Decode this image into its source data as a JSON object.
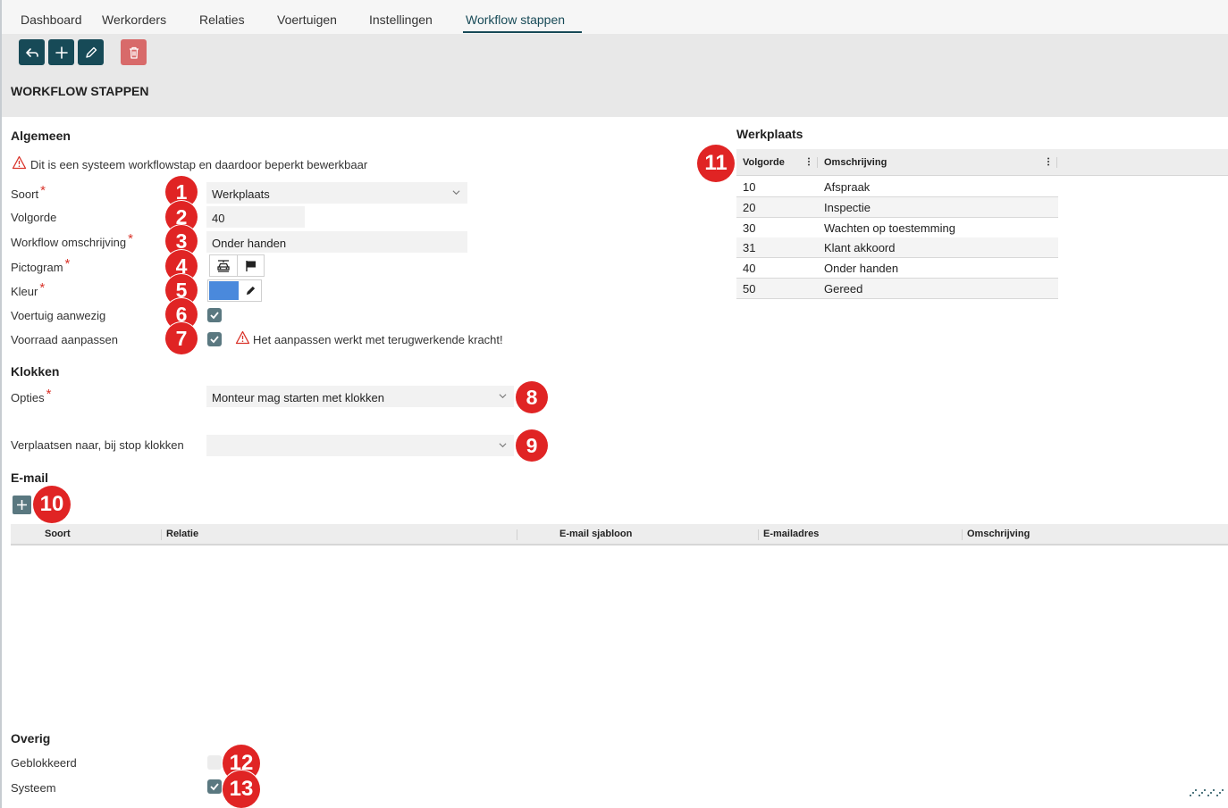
{
  "nav": {
    "items": [
      "Dashboard",
      "Werkorders",
      "Relaties",
      "Voertuigen",
      "Instellingen",
      "Workflow stappen"
    ],
    "active": "Workflow stappen"
  },
  "toolbar": {
    "back_icon": "arrow-back-icon",
    "add_icon": "plus-icon",
    "edit_icon": "pencil-icon",
    "delete_icon": "trash-icon"
  },
  "page": {
    "title": "WORKFLOW STAPPEN"
  },
  "algemeen": {
    "title": "Algemeen",
    "warning": "Dit is een systeem workflowstap en daardoor beperkt bewerkbaar",
    "soort": {
      "label": "Soort",
      "value": "Werkplaats"
    },
    "volgorde": {
      "label": "Volgorde",
      "value": "40"
    },
    "omschrijving": {
      "label": "Workflow omschrijving",
      "value": "Onder handen"
    },
    "pictogram": {
      "label": "Pictogram",
      "icons": [
        "car-lift-icon",
        "flag-icon"
      ]
    },
    "kleur": {
      "label": "Kleur",
      "value": "#4a89dc"
    },
    "voertuig": {
      "label": "Voertuig aanwezig",
      "checked": true
    },
    "voorraad": {
      "label": "Voorraad aanpassen",
      "checked": true,
      "warning": "Het aanpassen werkt met terugwerkende kracht!"
    }
  },
  "klokken": {
    "title": "Klokken",
    "opties": {
      "label": "Opties",
      "value": "Monteur mag starten met klokken"
    },
    "verplaatsen": {
      "label": "Verplaatsen naar, bij stop klokken",
      "value": ""
    }
  },
  "email": {
    "title": "E-mail",
    "columns": [
      "Soort",
      "Relatie",
      "E-mail sjabloon",
      "E-mailadres",
      "Omschrijving"
    ]
  },
  "overig": {
    "title": "Overig",
    "geblokkeerd": {
      "label": "Geblokkeerd",
      "checked": false
    },
    "systeem": {
      "label": "Systeem",
      "checked": true
    }
  },
  "werkplaats": {
    "title": "Werkplaats",
    "columns": [
      "Volgorde",
      "Omschrijving"
    ],
    "rows": [
      {
        "volgorde": "10",
        "omschrijving": "Afspraak"
      },
      {
        "volgorde": "20",
        "omschrijving": "Inspectie"
      },
      {
        "volgorde": "30",
        "omschrijving": "Wachten op toestemming"
      },
      {
        "volgorde": "31",
        "omschrijving": "Klant akkoord"
      },
      {
        "volgorde": "40",
        "omschrijving": "Onder handen"
      },
      {
        "volgorde": "50",
        "omschrijving": "Gereed"
      }
    ]
  },
  "badges": [
    "1",
    "2",
    "3",
    "4",
    "5",
    "6",
    "7",
    "8",
    "9",
    "10",
    "11",
    "12",
    "13"
  ],
  "colors": {
    "primary": "#174a57",
    "danger": "#d86a6a",
    "badge": "#e02424",
    "checkbox": "#5a7880"
  }
}
